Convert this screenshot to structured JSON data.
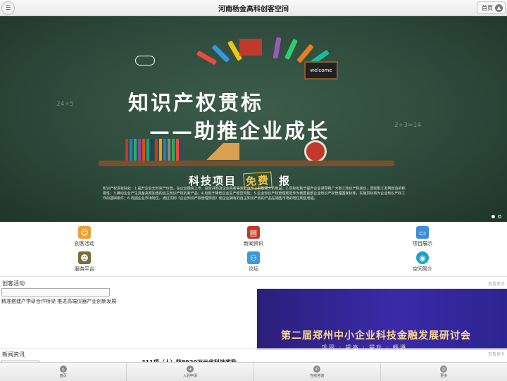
{
  "header": {
    "title": "河南杨金高科创客空间",
    "home_label": "首页",
    "menu_icon": "menu-icon",
    "home_icon": "arrow-up-icon"
  },
  "banner": {
    "headline_1": "知识产权贯标",
    "headline_2": "——助推企业成长",
    "subline_left": "科技项目",
    "subline_free": "免费",
    "subline_right": "报",
    "board_text": "welcome",
    "paragraph": "知识产权贯标好处：1.提升企业无形资产价值，在企业融资上市、投资并购及企业高新等资产运作上获取更大的收益；2.贯标有助于提升企业领导和广大职工知识产权意识，调动职工发明创造的积极性；3.推动企业产生具备高附加值的自主知识产权的新产品；4.有助于降低企业生产经营风险；5.企业知识产权管理规范作为我国首部企业知识产权管理国家标准，实施贯标将为企业知识产权工作的基础条件；6.巩固企业市场地位，通过贯彻《企业知识产权管理规范》使企业拥有的自主知识产权的产品在销售市场的地位明显增强。",
    "slide_count": 2,
    "active_slide": 1
  },
  "quick_links": [
    {
      "label": "创客活动",
      "icon": "people-icon",
      "color": "#e8a23a"
    },
    {
      "label": "新闻资讯",
      "icon": "newspaper-icon",
      "color": "#c0392b"
    },
    {
      "label": "项目展示",
      "icon": "monitor-icon",
      "color": "#3b8fd6"
    },
    {
      "label": "服务平台",
      "icon": "worker-icon",
      "color": "#7a6d3b"
    },
    {
      "label": "论坛",
      "icon": "group-icon",
      "color": "#3a9ad9"
    },
    {
      "label": "空间简介",
      "icon": "globe-icon",
      "color": "#1aa3c7"
    }
  ],
  "activities": {
    "title": "创客活动",
    "more": "查看更多",
    "caption": "精准搭建产学研合作桥梁 推进高端仪器产业创新发展",
    "ad_title": "第二届郑州中小企业科技金融发展研讨会",
    "ad_sub": "巩固 · 提高 · 提升 · 畅通"
  },
  "news": {
    "title": "新闻资讯",
    "more": "查看更多",
    "headline": "311项（人）获8920万元省科技奖励"
  },
  "footer": [
    {
      "label": "首页",
      "icon": "home-icon"
    },
    {
      "label": "入驻申请",
      "icon": "arrow-right-icon"
    },
    {
      "label": "在线咨询",
      "icon": "phone-icon"
    },
    {
      "label": "更多",
      "icon": "user-icon"
    }
  ]
}
